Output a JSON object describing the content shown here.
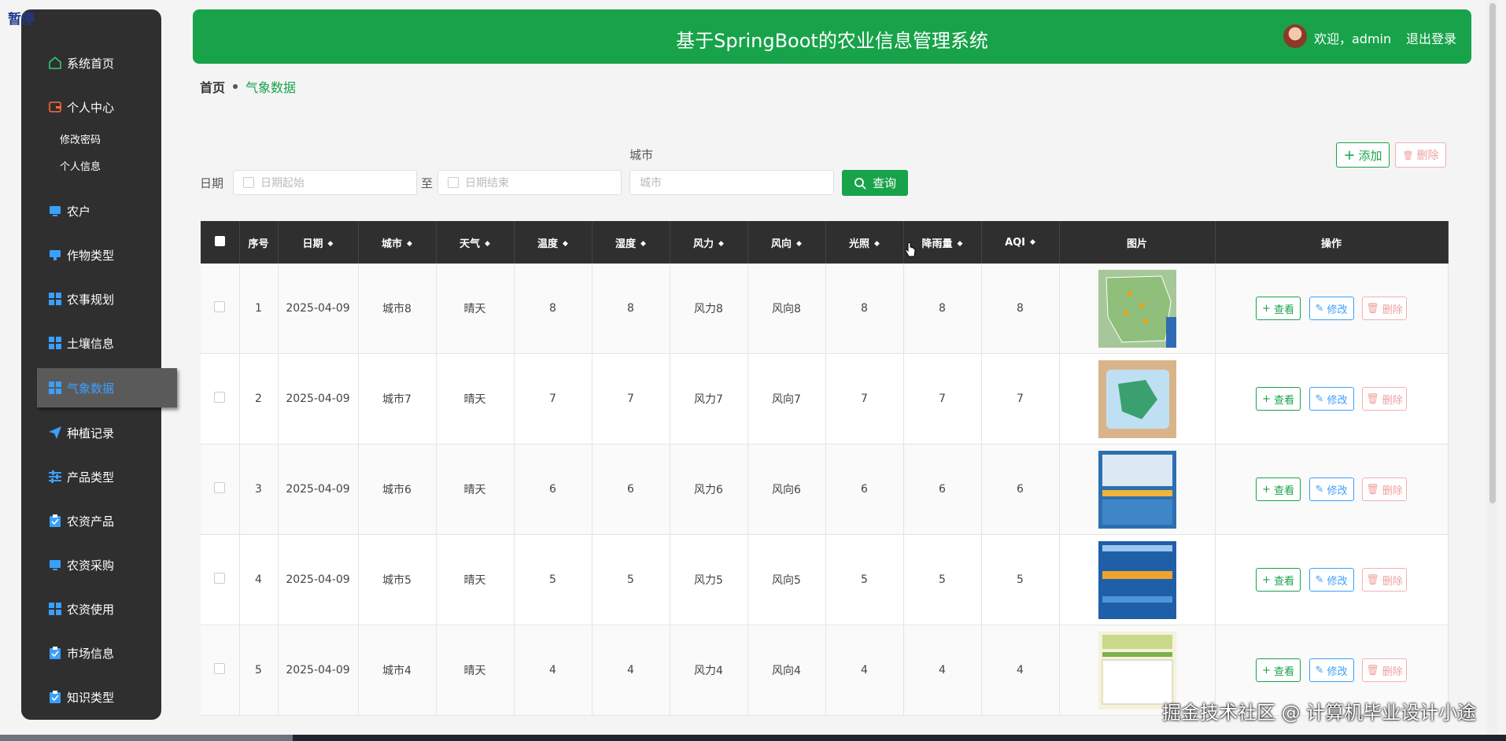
{
  "overlay": {
    "pause_label": "暂停",
    "watermark": "掘金技术社区 @ 计算机毕业设计小途"
  },
  "header": {
    "title": "基于SpringBoot的农业信息管理系统",
    "welcome": "欢迎，admin",
    "logout": "退出登录"
  },
  "sidebar": {
    "items": [
      {
        "label": "系统首页",
        "icon": "home-icon"
      },
      {
        "label": "个人中心",
        "icon": "wallet-icon"
      },
      {
        "label": "修改密码"
      },
      {
        "label": "个人信息"
      },
      {
        "label": "农户",
        "icon": "monitor-icon"
      },
      {
        "label": "作物类型",
        "icon": "monitor-icon"
      },
      {
        "label": "农事规划",
        "icon": "grid-icon"
      },
      {
        "label": "土壤信息",
        "icon": "grid-icon"
      },
      {
        "label": "气象数据",
        "icon": "grid-icon"
      },
      {
        "label": "种植记录",
        "icon": "send-icon"
      },
      {
        "label": "产品类型",
        "icon": "sliders-icon"
      },
      {
        "label": "农资产品",
        "icon": "clipboard-icon"
      },
      {
        "label": "农资采购",
        "icon": "monitor-icon"
      },
      {
        "label": "农资使用",
        "icon": "grid-icon"
      },
      {
        "label": "市场信息",
        "icon": "clipboard-icon"
      },
      {
        "label": "知识类型",
        "icon": "clipboard-icon"
      }
    ],
    "active_index": 8
  },
  "breadcrumb": {
    "home": "首页",
    "current": "气象数据"
  },
  "filters": {
    "date_label": "日期",
    "date_start_placeholder": "日期起始",
    "to_label": "至",
    "date_end_placeholder": "日期结束",
    "city_label": "城市",
    "city_placeholder": "城市",
    "search_button": "查询"
  },
  "actions": {
    "add": "添加",
    "delete": "删除"
  },
  "table": {
    "columns": [
      "序号",
      "日期",
      "城市",
      "天气",
      "温度",
      "湿度",
      "风力",
      "风向",
      "光照",
      "降雨量",
      "AQI",
      "图片",
      "操作"
    ],
    "rows": [
      {
        "no": "1",
        "date": "2025-04-09",
        "city": "城市8",
        "weather": "晴天",
        "temp": "8",
        "humidity": "8",
        "wind": "风力8",
        "direction": "风向8",
        "light": "8",
        "rain": "8",
        "aqi": "8"
      },
      {
        "no": "2",
        "date": "2025-04-09",
        "city": "城市7",
        "weather": "晴天",
        "temp": "7",
        "humidity": "7",
        "wind": "风力7",
        "direction": "风向7",
        "light": "7",
        "rain": "7",
        "aqi": "7"
      },
      {
        "no": "3",
        "date": "2025-04-09",
        "city": "城市6",
        "weather": "晴天",
        "temp": "6",
        "humidity": "6",
        "wind": "风力6",
        "direction": "风向6",
        "light": "6",
        "rain": "6",
        "aqi": "6"
      },
      {
        "no": "4",
        "date": "2025-04-09",
        "city": "城市5",
        "weather": "晴天",
        "temp": "5",
        "humidity": "5",
        "wind": "风力5",
        "direction": "风向5",
        "light": "5",
        "rain": "5",
        "aqi": "5"
      },
      {
        "no": "5",
        "date": "2025-04-09",
        "city": "城市4",
        "weather": "晴天",
        "temp": "4",
        "humidity": "4",
        "wind": "风力4",
        "direction": "风向4",
        "light": "4",
        "rain": "4",
        "aqi": "4"
      }
    ],
    "row_actions": {
      "view": "查看",
      "edit": "修改",
      "delete": "删除"
    }
  },
  "colors": {
    "brand": "#18a34a",
    "sidebar": "#2f2f2f",
    "link": "#3aa0ff",
    "danger": "#f0a0a0"
  }
}
